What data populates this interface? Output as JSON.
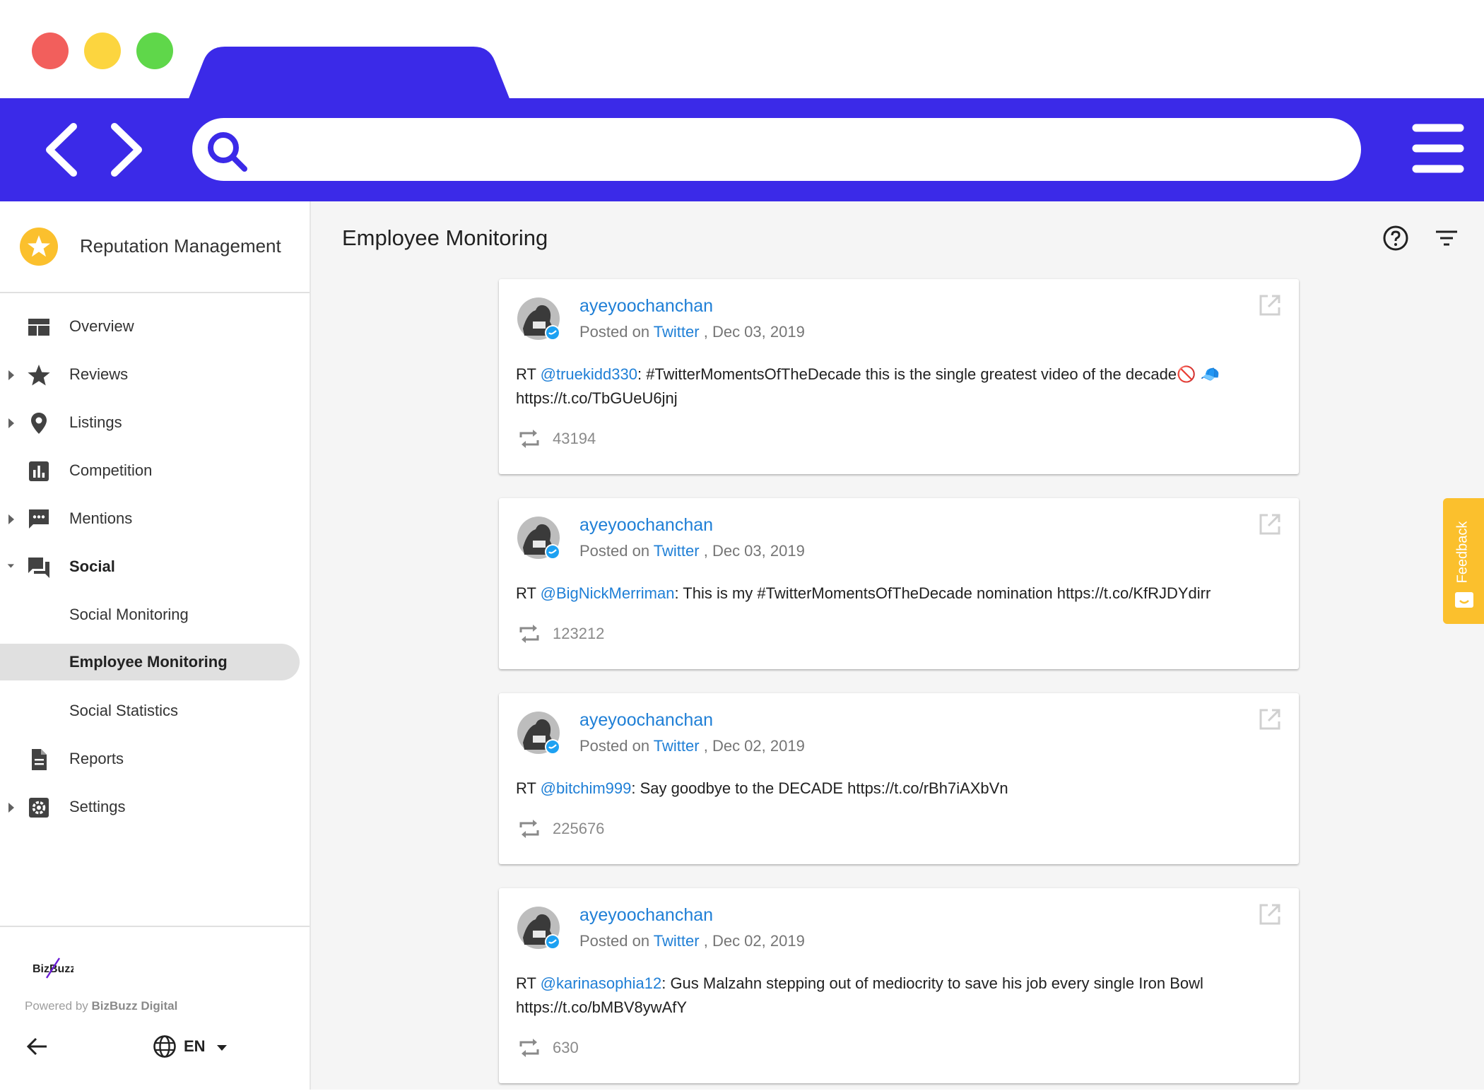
{
  "window": {
    "traffic_lights": [
      "#f25f5c",
      "#fcd53f",
      "#5fd74a"
    ],
    "accent": "#3b2ae8"
  },
  "browser": {
    "url_placeholder": "",
    "back_icon": "chevron-left-icon",
    "forward_icon": "chevron-right-icon",
    "search_icon": "search-icon",
    "menu_icon": "hamburger-menu-icon"
  },
  "sidebar": {
    "brand": "Reputation Management",
    "items": [
      {
        "label": "Overview",
        "icon": "overview-icon"
      },
      {
        "label": "Reviews",
        "icon": "star-icon"
      },
      {
        "label": "Listings",
        "icon": "location-pin-icon"
      },
      {
        "label": "Competition",
        "icon": "bar-chart-icon"
      },
      {
        "label": "Mentions",
        "icon": "chat-bubble-icon"
      },
      {
        "label": "Social",
        "icon": "forum-icon"
      },
      {
        "label": "Social Monitoring"
      },
      {
        "label": "Employee Monitoring"
      },
      {
        "label": "Social Statistics"
      },
      {
        "label": "Reports",
        "icon": "document-icon"
      },
      {
        "label": "Settings",
        "icon": "settings-icon"
      }
    ],
    "footer": {
      "logo_text": "BizBuzz",
      "powered_prefix": "Powered by",
      "powered_brand": "BizBuzz Digital",
      "language": "EN"
    }
  },
  "main": {
    "title": "Employee Monitoring",
    "posts": [
      {
        "author": "ayeyoochanchan",
        "posted_on": "Posted on",
        "platform": "Twitter",
        "date": ", Dec 03, 2019",
        "prefix": "RT ",
        "mention": "@truekidd330",
        "text": ": #TwitterMomentsOfTheDecade this is the single greatest video of the decade🚫 🧢",
        "text2": "https://t.co/TbGUeU6jnj",
        "retweets": "43194"
      },
      {
        "author": "ayeyoochanchan",
        "posted_on": "Posted on",
        "platform": "Twitter",
        "date": ", Dec 03, 2019",
        "prefix": "RT ",
        "mention": "@BigNickMerriman",
        "text": ": This is my #TwitterMomentsOfTheDecade nomination https://t.co/KfRJDYdirr",
        "text2": "",
        "retweets": "123212"
      },
      {
        "author": "ayeyoochanchan",
        "posted_on": "Posted on",
        "platform": "Twitter",
        "date": ", Dec 02, 2019",
        "prefix": "RT ",
        "mention": "@bitchim999",
        "text": ": Say goodbye to the DECADE  https://t.co/rBh7iAXbVn",
        "text2": "",
        "retweets": "225676"
      },
      {
        "author": "ayeyoochanchan",
        "posted_on": "Posted on",
        "platform": "Twitter",
        "date": ", Dec 02, 2019",
        "prefix": "RT ",
        "mention": "@karinasophia12",
        "text": ": Gus Malzahn stepping out of mediocrity to save his job every single Iron Bowl",
        "text2": " https://t.co/bMBV8ywAfY",
        "retweets": "630"
      }
    ]
  },
  "feedback": {
    "label": "Feedback",
    "color": "#fbc02d"
  }
}
